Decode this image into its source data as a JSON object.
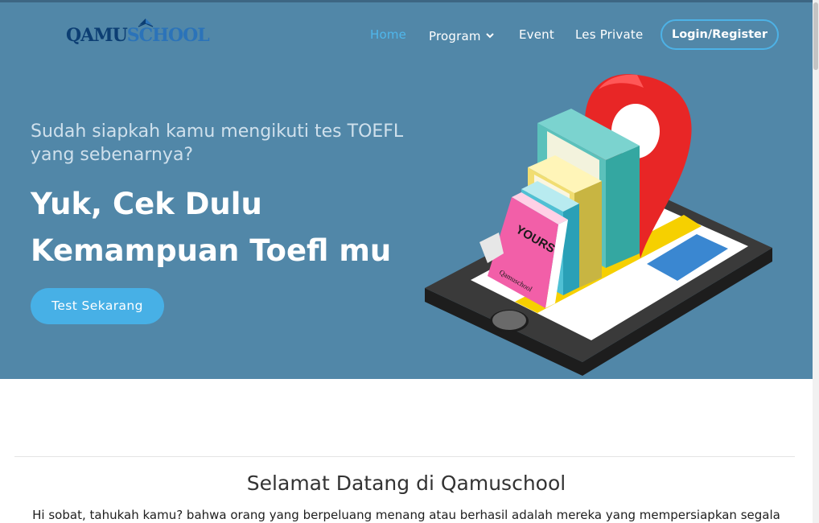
{
  "header": {
    "logo_text_a": "QAMU",
    "logo_text_b": "SCHOOL",
    "nav": [
      {
        "label": "Home",
        "active": true
      },
      {
        "label": "Program",
        "has_dropdown": true
      },
      {
        "label": "Event"
      },
      {
        "label": "Les Private"
      }
    ],
    "login_label": "Login/Register"
  },
  "hero": {
    "subtitle": "Sudah siapkah kamu mengikuti tes TOEFL yang sebenarnya?",
    "title_line1": "Yuk, Cek Dulu",
    "title_line2": "Kemampuan Toefl mu",
    "cta_label": "Test Sekarang",
    "book_title": "YOURS",
    "book_author": "Qamuschool"
  },
  "welcome": {
    "title": "Selamat Datang di Qamuschool",
    "text": "Hi sobat, tahukah kamu? bahwa orang yang berpeluang menang atau berhasil adalah mereka yang mempersiapkan segala"
  },
  "colors": {
    "hero_bg": "#5187a8",
    "accent": "#47b0e6",
    "active_nav": "#4fb7ec"
  }
}
